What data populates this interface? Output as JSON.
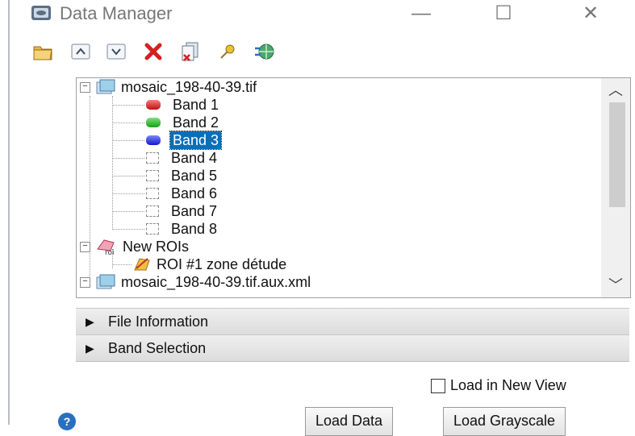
{
  "window": {
    "title": "Data Manager",
    "controls": {
      "minimize": "—",
      "maximize": "☐",
      "close": "✕"
    }
  },
  "toolbar": {
    "buttons": [
      {
        "name": "open-file",
        "icon": "folder-open-icon"
      },
      {
        "name": "move-up",
        "icon": "chevron-up-icon"
      },
      {
        "name": "move-down",
        "icon": "chevron-down-icon"
      },
      {
        "name": "remove",
        "icon": "red-x-icon"
      },
      {
        "name": "close-all",
        "icon": "files-close-icon"
      },
      {
        "name": "pin",
        "icon": "pin-icon"
      },
      {
        "name": "sync",
        "icon": "globe-link-icon"
      }
    ]
  },
  "tree": {
    "file1": "mosaic_198-40-39.tif",
    "bands": [
      {
        "label": "Band 1",
        "swatch": "red"
      },
      {
        "label": "Band 2",
        "swatch": "green"
      },
      {
        "label": "Band 3",
        "swatch": "blue",
        "selected": true
      },
      {
        "label": "Band 4",
        "swatch": "empty"
      },
      {
        "label": "Band 5",
        "swatch": "empty"
      },
      {
        "label": "Band 6",
        "swatch": "empty"
      },
      {
        "label": "Band 7",
        "swatch": "empty"
      },
      {
        "label": "Band 8",
        "swatch": "empty"
      }
    ],
    "rois_group": "New ROIs",
    "roi_item": "ROI #1 zone détude",
    "file2": "mosaic_198-40-39.tif.aux.xml"
  },
  "panels": {
    "file_info": "File Information",
    "band_selection": "Band Selection"
  },
  "options": {
    "load_in_new_view": "Load in New View",
    "load_in_new_view_checked": false
  },
  "buttons": {
    "load_data": "Load Data",
    "load_grayscale": "Load Grayscale"
  },
  "colors": {
    "selection": "#0b6fb8",
    "band1": "#c01010",
    "band2": "#16a116",
    "band3": "#1018c8"
  }
}
